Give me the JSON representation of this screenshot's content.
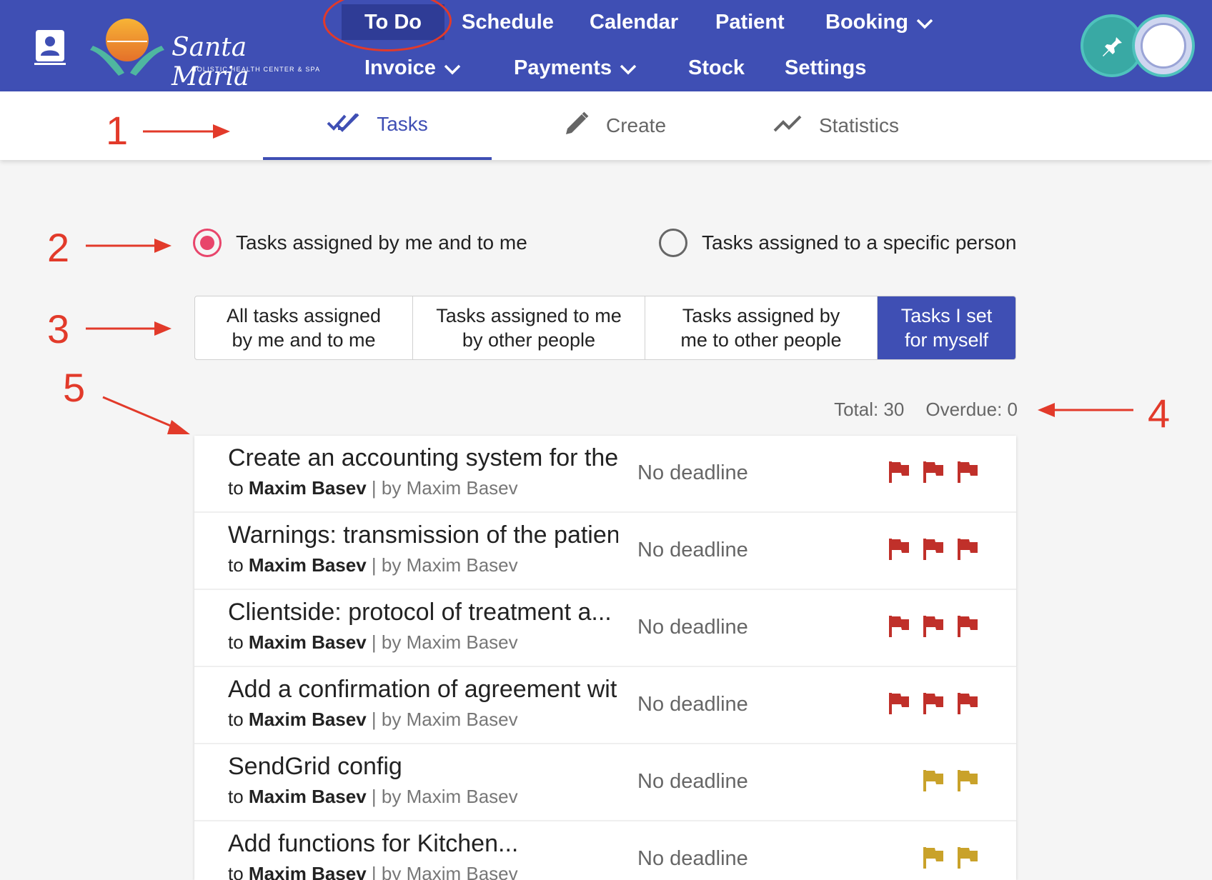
{
  "nav": {
    "row1": [
      {
        "label": "To Do",
        "active": true
      },
      {
        "label": "Schedule"
      },
      {
        "label": "Calendar"
      },
      {
        "label": "Patient"
      },
      {
        "label": "Booking",
        "dropdown": true
      }
    ],
    "row2": [
      {
        "label": "Invoice",
        "dropdown": true
      },
      {
        "label": "Payments",
        "dropdown": true
      },
      {
        "label": "Stock"
      },
      {
        "label": "Settings"
      }
    ]
  },
  "logo": {
    "name": "Santa Maria",
    "tagline": "HOLISTIC HEALTH CENTER & SPA"
  },
  "tabs": [
    {
      "label": "Tasks",
      "icon": "double-check-icon",
      "active": true
    },
    {
      "label": "Create",
      "icon": "pencil-icon"
    },
    {
      "label": "Statistics",
      "icon": "trend-line-icon"
    }
  ],
  "annotations": [
    "1",
    "2",
    "3",
    "4",
    "5"
  ],
  "radios": [
    {
      "label": "Tasks assigned by me and to me",
      "checked": true
    },
    {
      "label": "Tasks assigned to a specific person",
      "checked": false
    }
  ],
  "filters": [
    {
      "line1": "All tasks assigned",
      "line2": "by me and to me"
    },
    {
      "line1": "Tasks assigned to me",
      "line2": "by other people"
    },
    {
      "line1": "Tasks assigned by",
      "line2": "me to other people"
    },
    {
      "line1": "Tasks I set",
      "line2": "for myself",
      "active": true
    }
  ],
  "totals": {
    "total": "Total: 30",
    "overdue": "Overdue: 0"
  },
  "tasks": [
    {
      "title": "Create an accounting system for the clinic",
      "to_prefix": "to",
      "assignee": "Maxim Basev",
      "by": "| by Maxim Basev",
      "deadline": "No deadline",
      "flags": 3,
      "flag_color": "#c0302a"
    },
    {
      "title": "Warnings: transmission of the patient",
      "to_prefix": "to",
      "assignee": "Maxim Basev",
      "by": "| by Maxim Basev",
      "deadline": "No deadline",
      "flags": 3,
      "flag_color": "#c0302a"
    },
    {
      "title": "Clientside: protocol of treatment a...",
      "to_prefix": "to",
      "assignee": "Maxim Basev",
      "by": "| by Maxim Basev",
      "deadline": "No deadline",
      "flags": 3,
      "flag_color": "#c0302a"
    },
    {
      "title": "Add a confirmation of agreement with",
      "to_prefix": "to",
      "assignee": "Maxim Basev",
      "by": "| by Maxim Basev",
      "deadline": "No deadline",
      "flags": 3,
      "flag_color": "#c0302a"
    },
    {
      "title": "SendGrid config",
      "to_prefix": "to",
      "assignee": "Maxim Basev",
      "by": "| by Maxim Basev",
      "deadline": "No deadline",
      "flags": 2,
      "flag_color": "#c9a22a"
    },
    {
      "title": "Add functions for Kitchen...",
      "to_prefix": "to",
      "assignee": "Maxim Basev",
      "by": "| by Maxim Basev",
      "deadline": "No deadline",
      "flags": 2,
      "flag_color": "#c9a22a"
    }
  ],
  "colors": {
    "primary": "#3f4fb4",
    "annotation": "#e23a2a",
    "radio_checked": "#e8456b"
  }
}
